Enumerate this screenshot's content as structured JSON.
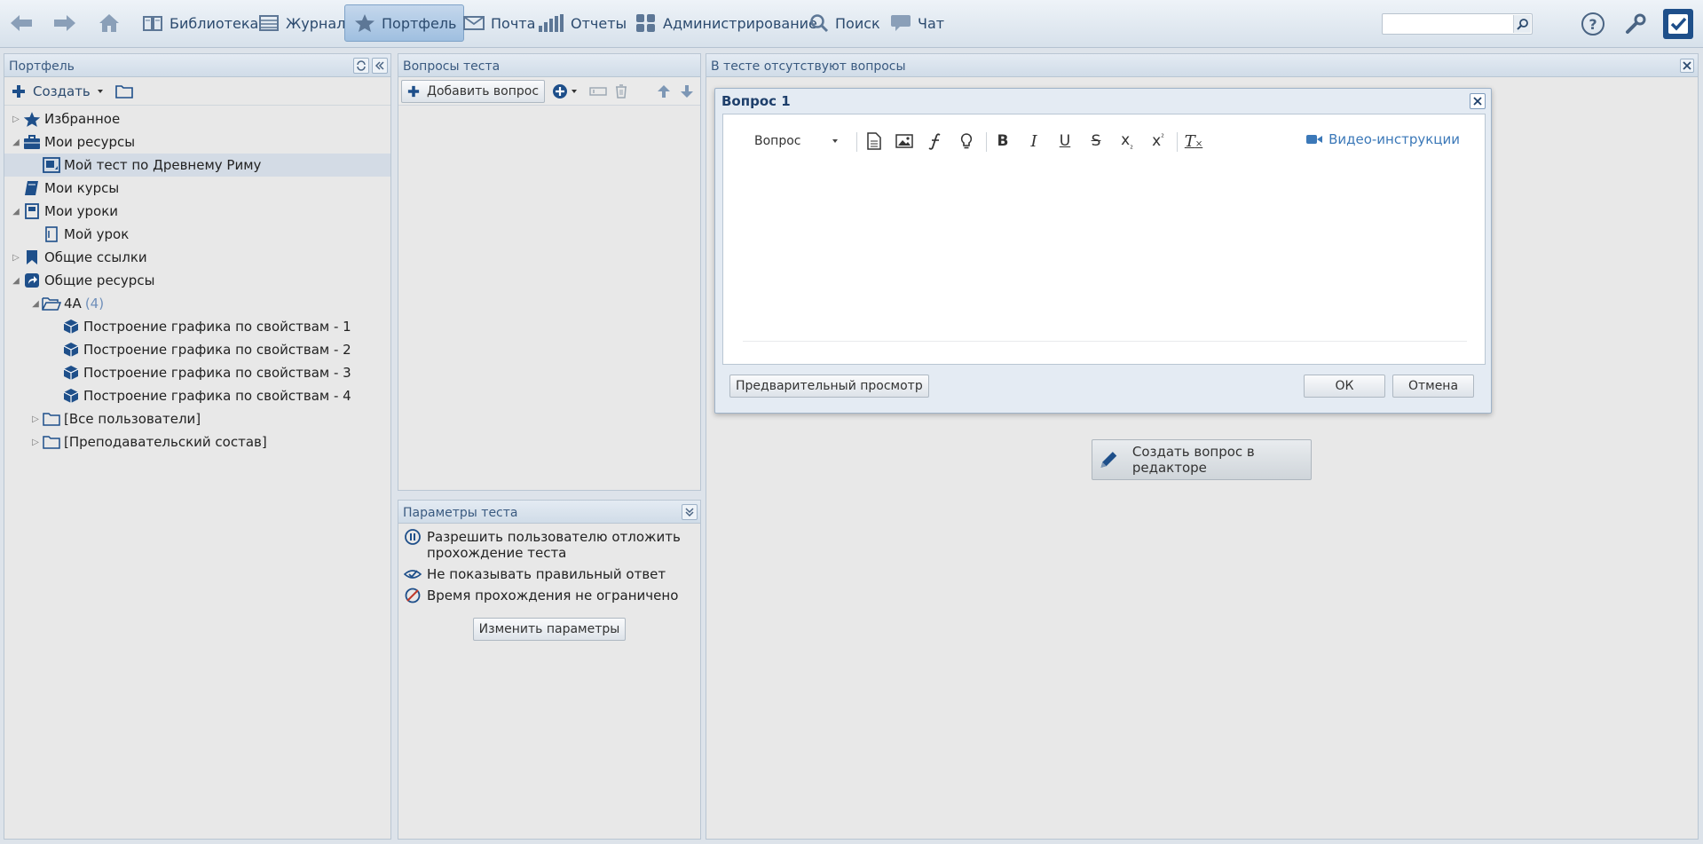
{
  "nav": {
    "library": "Библиотека",
    "journal": "Журнал",
    "portfolio": "Портфель",
    "mail": "Почта",
    "reports": "Отчеты",
    "admin": "Администрирование",
    "search": "Поиск",
    "chat": "Чат"
  },
  "search": {
    "value": "",
    "placeholder": ""
  },
  "portfolio_panel": {
    "title": "Портфель",
    "create_label": "Создать",
    "tree": {
      "favorites": "Избранное",
      "my_resources": "Мои ресурсы",
      "my_test": "Мой тест по Древнему Риму",
      "my_courses": "Мои курсы",
      "my_lessons": "Мои уроки",
      "my_lesson": "Мой урок",
      "shared_links": "Общие ссылки",
      "shared_resources": "Общие ресурсы",
      "group_4a": "4А",
      "group_4a_count": "(4)",
      "item1": "Построение графика по свойствам - 1",
      "item2": "Построение графика по свойствам - 2",
      "item3": "Построение графика по свойствам - 3",
      "item4": "Построение графика по свойствам - 4",
      "all_users": "[Все пользователи]",
      "teachers": "[Преподавательский состав]"
    }
  },
  "questions_panel": {
    "title": "Вопросы теста",
    "add_label": "Добавить вопрос"
  },
  "params_panel": {
    "title": "Параметры теста",
    "allow_postpone": "Разрешить пользователю отложить прохождение теста",
    "hide_answer": "Не показывать правильный ответ",
    "time_unlimited": "Время прохождения не ограничено",
    "change_label": "Изменить параметры"
  },
  "main_panel": {
    "title": "В тесте отсутствуют вопросы",
    "create_in_editor": "Создать вопрос в редакторе"
  },
  "dialog": {
    "title": "Вопрос 1",
    "format_select": "Вопрос",
    "video_link": "Видео-инструкции",
    "preview_label": "Предварительный просмотр",
    "ok_label": "ОК",
    "cancel_label": "Отмена"
  },
  "colors": {
    "accent": "#1e4f8a",
    "link": "#3b78b8",
    "header_text": "#3a5a80"
  }
}
